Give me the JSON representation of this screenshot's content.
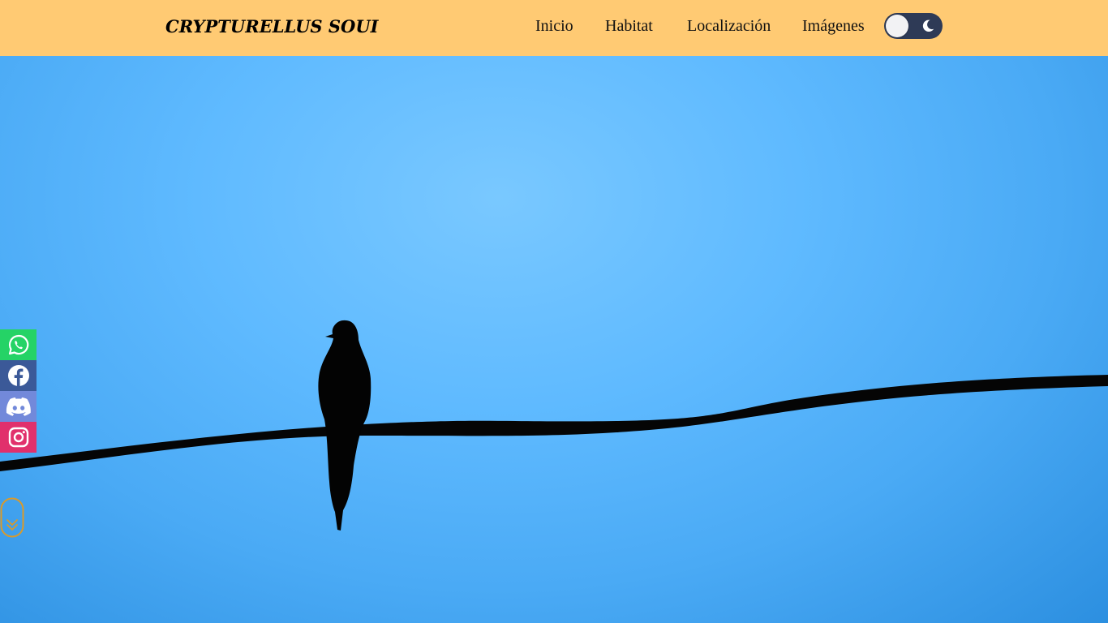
{
  "brand": {
    "title": "CRYPTURELLUS SOUI"
  },
  "nav": {
    "items": [
      {
        "label": "Inicio"
      },
      {
        "label": "Habitat"
      },
      {
        "label": "Localización"
      },
      {
        "label": "Imágenes"
      }
    ]
  },
  "theme_toggle": {
    "state": "light",
    "icon": "moon-icon"
  },
  "colors": {
    "navbar": "#ffca73",
    "sky": "#5fbaff",
    "toggle": "#2e3a56",
    "scroll_indicator": "#d99a2b",
    "whatsapp": "#25d366",
    "facebook": "#3b5998",
    "discord": "#7289da",
    "instagram": "#e1306c"
  },
  "social": [
    {
      "icon": "whatsapp-icon"
    },
    {
      "icon": "facebook-icon"
    },
    {
      "icon": "discord-icon"
    },
    {
      "icon": "instagram-icon"
    }
  ],
  "hero": {
    "image": "bird-on-wire-silhouette",
    "scroll_icon": "chevron-down-icon"
  }
}
